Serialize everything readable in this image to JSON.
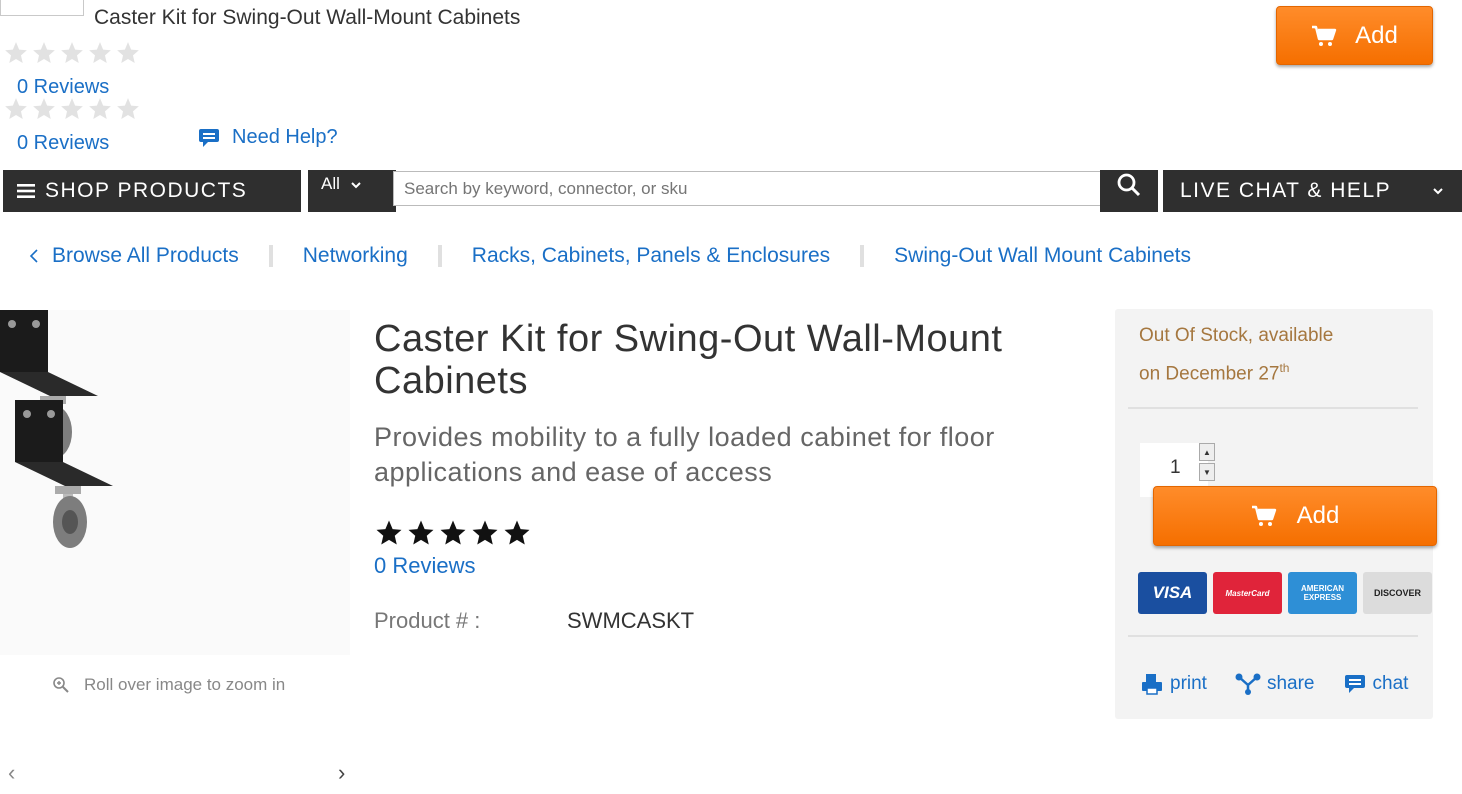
{
  "sticky_header": {
    "title": "Caster Kit for Swing-Out Wall-Mount Cabinets",
    "reviews_1": "0 Reviews",
    "reviews_2": "0 Reviews",
    "need_help": "Need Help?",
    "add_label": "Add"
  },
  "nav": {
    "shop_products": "SHOP PRODUCTS",
    "category_select": "All",
    "search_placeholder": "Search by keyword, connector, or sku",
    "live_chat": "LIVE CHAT & HELP"
  },
  "breadcrumb": {
    "items": [
      "Browse All Products",
      "Networking",
      "Racks, Cabinets, Panels & Enclosures",
      "Swing-Out Wall Mount Cabinets"
    ]
  },
  "product": {
    "title": "Caster Kit for Swing-Out Wall-Mount Cabinets",
    "subtitle": "Provides mobility to a fully loaded cabinet for floor applications and ease of access",
    "reviews": "0 Reviews",
    "rating": 5,
    "number_label": "Product # :",
    "number_value": "SWMCASKT",
    "zoom_hint": "Roll over image to zoom in"
  },
  "buy_box": {
    "stock_line1": "Out Of Stock, available",
    "stock_line2": "on December 27",
    "stock_sup": "th",
    "quantity": "1",
    "add_label": "Add",
    "cards": [
      "VISA",
      "MasterCard",
      "AMERICAN EXPRESS",
      "DISCOVER"
    ],
    "actions": {
      "print": "print",
      "share": "share",
      "chat": "chat"
    }
  },
  "colors": {
    "accent": "#f56f00",
    "link": "#1a6fc6",
    "nav_bg": "#2f2f2f",
    "stock": "#a5773f"
  }
}
